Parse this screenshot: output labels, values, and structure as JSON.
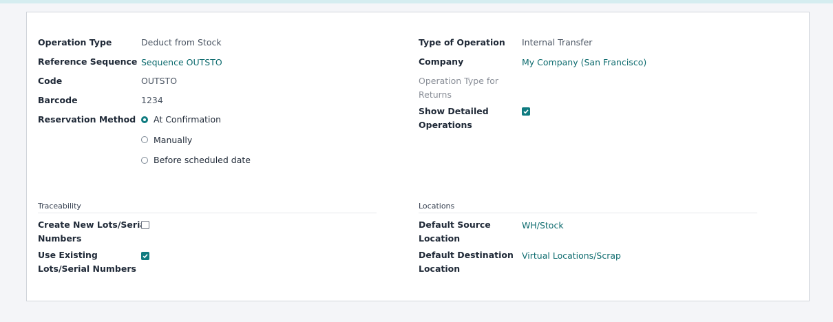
{
  "general": {
    "operation_type": {
      "label": "Operation Type",
      "value": "Deduct from Stock"
    },
    "reference_sequence": {
      "label": "Reference Sequence",
      "value": "Sequence OUTSTO"
    },
    "code": {
      "label": "Code",
      "value": "OUTSTO"
    },
    "barcode": {
      "label": "Barcode",
      "value": "1234"
    },
    "reservation_method": {
      "label": "Reservation Method",
      "options": [
        {
          "label": "At Confirmation",
          "selected": true
        },
        {
          "label": "Manually",
          "selected": false
        },
        {
          "label": "Before scheduled date",
          "selected": false
        }
      ]
    },
    "type_of_operation": {
      "label": "Type of Operation",
      "value": "Internal Transfer"
    },
    "company": {
      "label": "Company",
      "value": "My Company (San Francisco)"
    },
    "return_type": {
      "label_line1": "Operation Type for",
      "label_line2": "Returns"
    },
    "show_detailed": {
      "label_line1": "Show Detailed",
      "label_line2": "Operations",
      "checked": true
    }
  },
  "traceability": {
    "title": "Traceability",
    "create_lots": {
      "label_line1": "Create New Lots/Serial",
      "label_line2": "Numbers",
      "checked": false
    },
    "use_existing": {
      "label_line1": "Use Existing",
      "label_line2": "Lots/Serial Numbers",
      "checked": true
    }
  },
  "locations": {
    "title": "Locations",
    "default_source": {
      "label_line1": "Default Source",
      "label_line2": "Location",
      "value": "WH/Stock"
    },
    "default_destination": {
      "label_line1": "Default Destination",
      "label_line2": "Location",
      "value": "Virtual Locations/Scrap"
    }
  },
  "colors": {
    "accent": "#0f7b80",
    "link": "#0d6b6e",
    "top_bar": "#d5edf0"
  }
}
